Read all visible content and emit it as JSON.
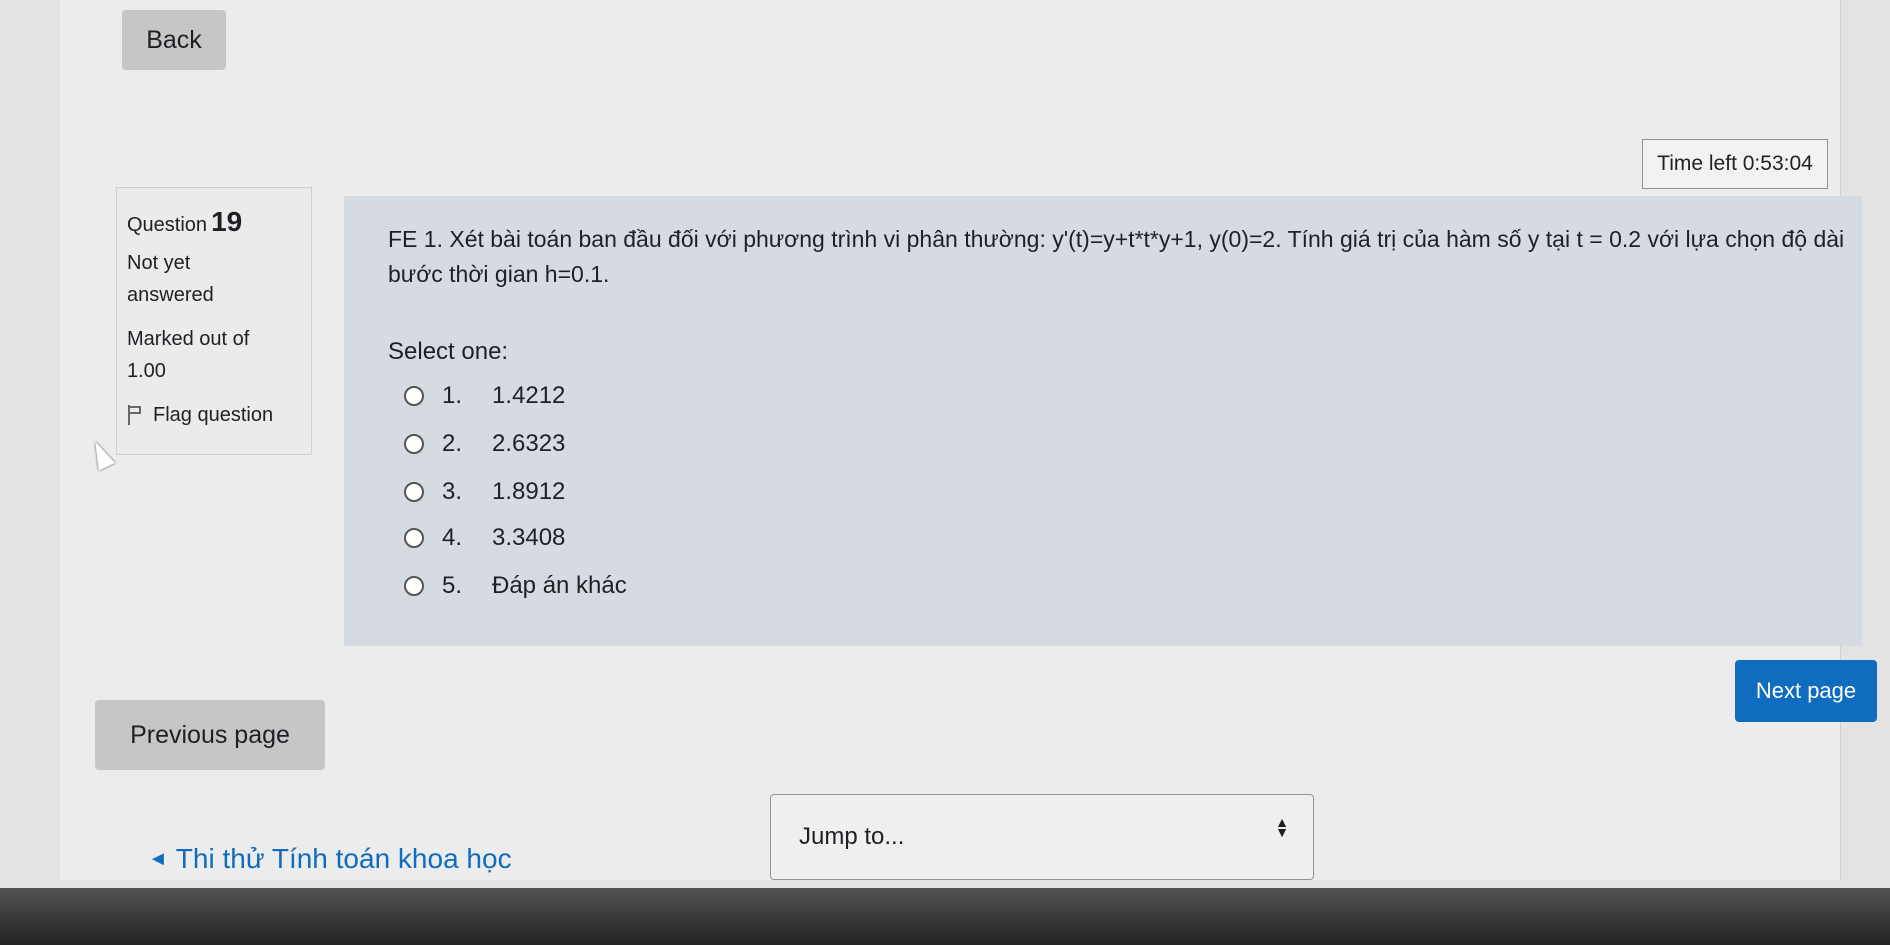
{
  "nav": {
    "back_label": "Back"
  },
  "timer": {
    "label": "Time left",
    "value": "0:53:04"
  },
  "question_info": {
    "question_label": "Question",
    "question_number": "19",
    "status_line1": "Not yet",
    "status_line2": "answered",
    "marks_line1": "Marked out of",
    "marks_line2": "1.00",
    "flag_label": "Flag question"
  },
  "question": {
    "text": "FE 1. Xét bài toán ban đầu đối với phương trình vi phân thường: y'(t)=y+t*t*y+1, y(0)=2. Tính giá trị của hàm số y tại t = 0.2 với lựa chọn độ dài bước thời gian h=0.1.",
    "select_prompt": "Select one:",
    "options": [
      {
        "num": "1.",
        "text": "1.4212"
      },
      {
        "num": "2.",
        "text": "2.6323"
      },
      {
        "num": "3.",
        "text": "1.8912"
      },
      {
        "num": "4.",
        "text": "3.3408"
      },
      {
        "num": "5.",
        "text": "Đáp án khác"
      }
    ]
  },
  "footer": {
    "next_label": "Next page",
    "prev_label": "Previous page",
    "prev_link": "Thi thử Tính toán khoa học",
    "jump_placeholder": "Jump to..."
  }
}
